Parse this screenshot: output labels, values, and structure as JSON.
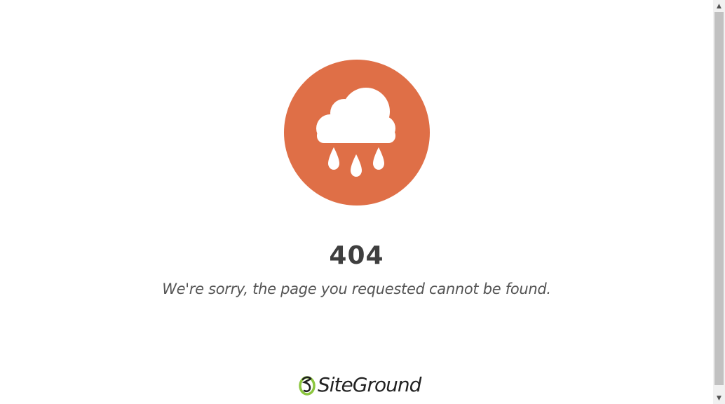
{
  "error": {
    "code": "404",
    "message": "We're sorry, the page you requested cannot be found."
  },
  "icons": {
    "main": "rain-cloud-icon",
    "logo_mark": "siteground-logo-icon"
  },
  "logo": {
    "text": "SiteGround"
  },
  "scrollbar": {
    "up_arrow": "▲",
    "down_arrow": "▼"
  },
  "colors": {
    "circle": "#df6f47",
    "heading": "#3f3f3f",
    "message": "#555555",
    "logo_green": "#8cc63f"
  }
}
